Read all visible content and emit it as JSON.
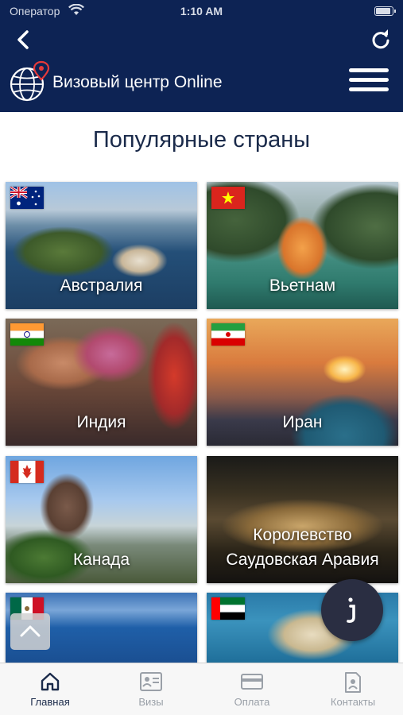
{
  "status_bar": {
    "carrier": "Оператор",
    "time": "1:10 AM"
  },
  "header": {
    "title": "Визовый центр Online"
  },
  "main": {
    "section_title": "Популярные страны",
    "countries": [
      {
        "name": "Австралия"
      },
      {
        "name": "Вьетнам"
      },
      {
        "name": "Индия"
      },
      {
        "name": "Иран"
      },
      {
        "name": "Канада"
      },
      {
        "name": "Королевство Саудовская Аравия",
        "line1": "Королевство",
        "line2": "Саудовская Аравия"
      },
      {
        "name": ""
      },
      {
        "name": ""
      }
    ]
  },
  "bottom_nav": {
    "items": [
      {
        "label": "Главная",
        "icon": "home-icon",
        "active": true
      },
      {
        "label": "Визы",
        "icon": "id-card-icon",
        "active": false
      },
      {
        "label": "Оплата",
        "icon": "credit-card-icon",
        "active": false
      },
      {
        "label": "Контакты",
        "icon": "contact-document-icon",
        "active": false
      }
    ]
  },
  "colors": {
    "header_bg": "#0d2354",
    "title_text": "#1a2a4a",
    "active_nav": "#1a2a4a",
    "inactive_nav": "#9aa0a8"
  }
}
